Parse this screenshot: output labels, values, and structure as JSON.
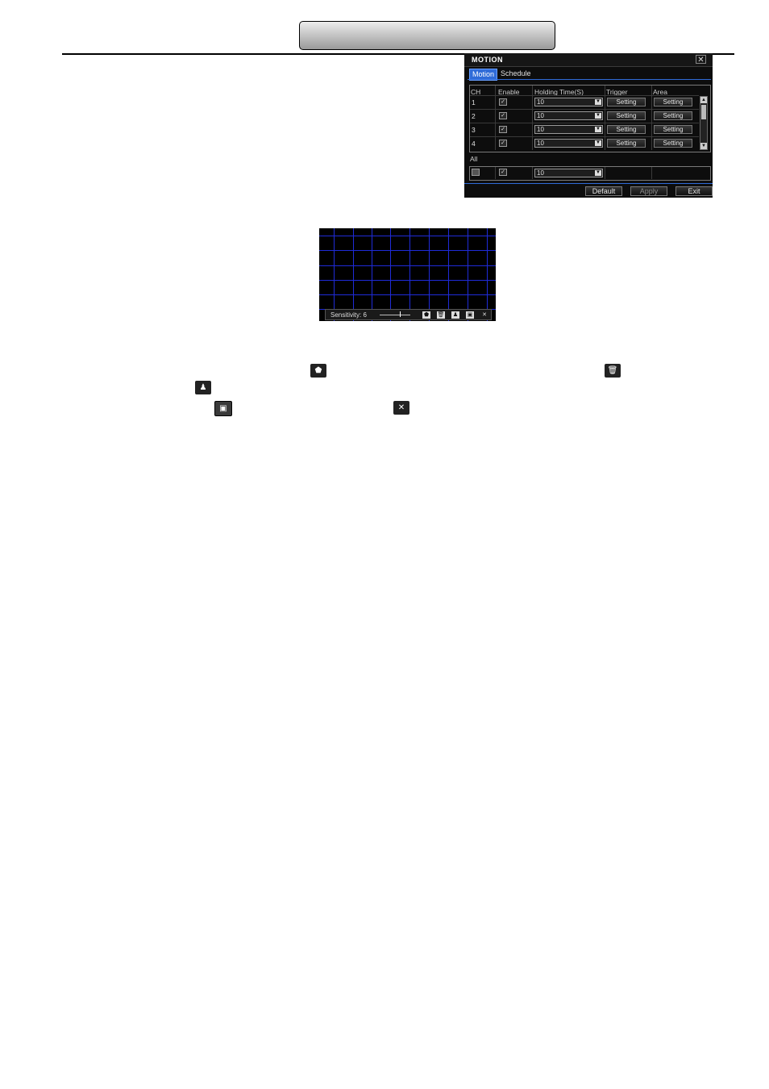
{
  "dialog": {
    "title": "MOTION",
    "close": "✕",
    "tabs": [
      "Motion",
      "Schedule"
    ],
    "columns": [
      "CH",
      "Enable",
      "Holding Time(S)",
      "Trigger",
      "Area"
    ],
    "rows": [
      {
        "ch": "1",
        "enabled": true,
        "holding": "10",
        "trigger": "Setting",
        "area": "Setting"
      },
      {
        "ch": "2",
        "enabled": true,
        "holding": "10",
        "trigger": "Setting",
        "area": "Setting"
      },
      {
        "ch": "3",
        "enabled": true,
        "holding": "10",
        "trigger": "Setting",
        "area": "Setting"
      },
      {
        "ch": "4",
        "enabled": true,
        "holding": "10",
        "trigger": "Setting",
        "area": "Setting"
      }
    ],
    "all_label": "All",
    "all_row": {
      "holding": "10"
    },
    "buttons": {
      "default": "Default",
      "apply": "Apply",
      "exit": "Exit"
    }
  },
  "area_setup": {
    "sensitivity_label": "Sensitivity:",
    "sensitivity_value": "6"
  }
}
